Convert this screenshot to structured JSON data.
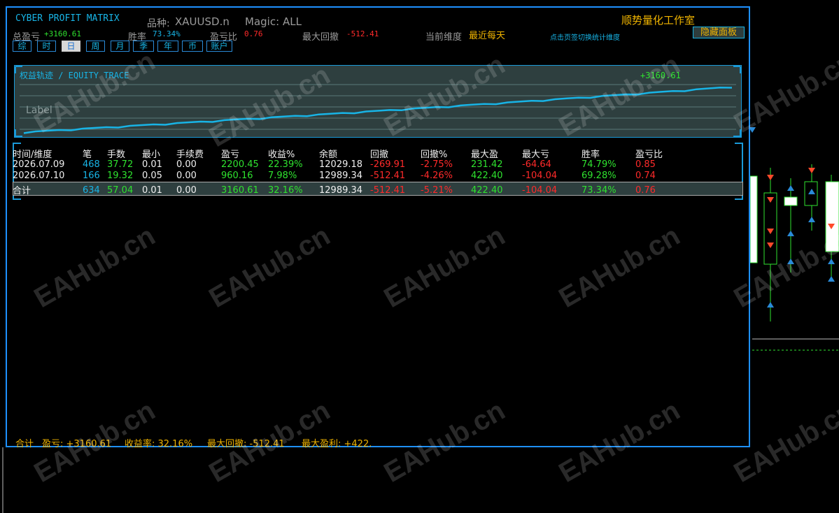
{
  "panel": {
    "title": "CYBER PROFIT MATRIX",
    "symbol_label": "品种:",
    "symbol_value": "XAUUSD.n",
    "magic_label": "Magic:",
    "magic_value": "ALL",
    "studio_name": "顺势量化工作室",
    "hide_button": "隐藏面板",
    "hint": "点击页签切换统计维度"
  },
  "summary": {
    "total_pl_label": "总盈亏",
    "total_pl_value": "+3160.61",
    "win_rate_label": "胜率",
    "win_rate_value": "73.34%",
    "pl_ratio_label": "盈亏比",
    "pl_ratio_value": "0.76",
    "max_dd_label": "最大回撤",
    "max_dd_value": "-512.41",
    "dimension_label": "当前维度",
    "dimension_value": "最近每天"
  },
  "tabs": [
    "综",
    "时",
    "日",
    "周",
    "月",
    "季",
    "年",
    "币",
    "账户"
  ],
  "active_tab": "日",
  "equity": {
    "title": "权益轨迹 / EQUITY TRACE",
    "value_label": "+3160.61",
    "placeholder": "Label"
  },
  "table": {
    "headers": [
      "时间/维度",
      "笔",
      "手数",
      "最小",
      "手续费",
      "盈亏",
      "收益%",
      "余额",
      "回撤",
      "回撤%",
      "最大盈",
      "最大亏",
      "胜率",
      "盈亏比"
    ],
    "rows": [
      [
        "2026.07.09",
        "468",
        "37.72",
        "0.01",
        "0.00",
        "2200.45",
        "22.39%",
        "12029.18",
        "-269.91",
        "-2.75%",
        "231.42",
        "-64.64",
        "74.79%",
        "0.85"
      ],
      [
        "2026.07.10",
        "166",
        "19.32",
        "0.05",
        "0.00",
        "960.16",
        "7.98%",
        "12989.34",
        "-512.41",
        "-4.26%",
        "422.40",
        "-104.04",
        "69.28%",
        "0.74"
      ]
    ],
    "total": [
      "合计",
      "634",
      "57.04",
      "0.01",
      "0.00",
      "3160.61",
      "32.16%",
      "12989.34",
      "-512.41",
      "-5.21%",
      "422.40",
      "-104.04",
      "73.34%",
      "0.76"
    ]
  },
  "footer": {
    "total_label": "合计",
    "pl": "盈亏: +3160.61",
    "return": "收益率: 32.16%",
    "max_dd": "最大回撤: -512.41",
    "max_profit": "最大盈利: +422."
  },
  "watermark": "EAHub.cn",
  "colors": {
    "accent": "#1e90ff",
    "positive": "#2fe22f",
    "negative": "#ff2a2a",
    "gold": "#f0b400",
    "cyan": "#18b4e6"
  }
}
